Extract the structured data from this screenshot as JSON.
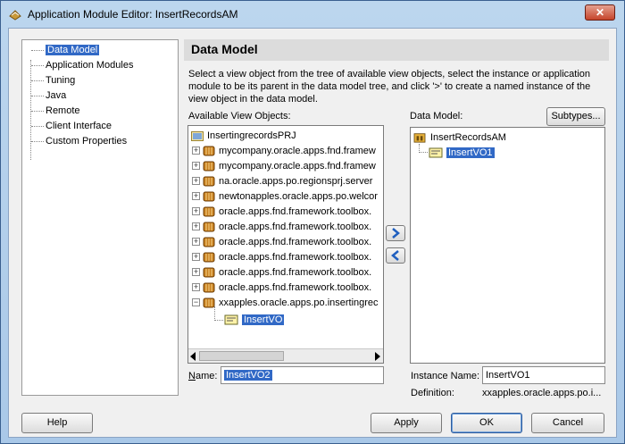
{
  "window": {
    "title": "Application Module Editor: InsertRecordsAM",
    "close_glyph": "✕"
  },
  "nav": {
    "items": [
      "Data Model",
      "Application Modules",
      "Tuning",
      "Java",
      "Remote",
      "Client Interface",
      "Custom Properties"
    ]
  },
  "header": {
    "title": "Data Model"
  },
  "description": "Select a view object from the tree of available view objects, select the instance or application module to be its parent in the data model tree, and click '>' to create a named instance of the view object in the data model.",
  "available": {
    "label": "Available View Objects:",
    "root": "InsertingrecordsPRJ",
    "packages": [
      "mycompany.oracle.apps.fnd.framew",
      "mycompany.oracle.apps.fnd.framew",
      "na.oracle.apps.po.regionsprj.server",
      "newtonapples.oracle.apps.po.welcor",
      "oracle.apps.fnd.framework.toolbox.",
      "oracle.apps.fnd.framework.toolbox.",
      "oracle.apps.fnd.framework.toolbox.",
      "oracle.apps.fnd.framework.toolbox.",
      "oracle.apps.fnd.framework.toolbox.",
      "oracle.apps.fnd.framework.toolbox.",
      "xxapples.oracle.apps.po.insertingrec"
    ],
    "child": "InsertVO"
  },
  "name_field": {
    "label": "Name:",
    "value": "InsertVO2"
  },
  "data_model": {
    "label": "Data Model:",
    "subtypes_button": "Subtypes...",
    "root": "InsertRecordsAM",
    "child": "InsertVO1"
  },
  "instance_name": {
    "label": "Instance Name:",
    "value": "InsertVO1"
  },
  "definition": {
    "label": "Definition:",
    "value": "xxapples.oracle.apps.po.i..."
  },
  "buttons": {
    "help": "Help",
    "apply": "Apply",
    "ok": "OK",
    "cancel": "Cancel"
  },
  "colors": {
    "selection": "#3169c6",
    "package": "#c8801e"
  }
}
